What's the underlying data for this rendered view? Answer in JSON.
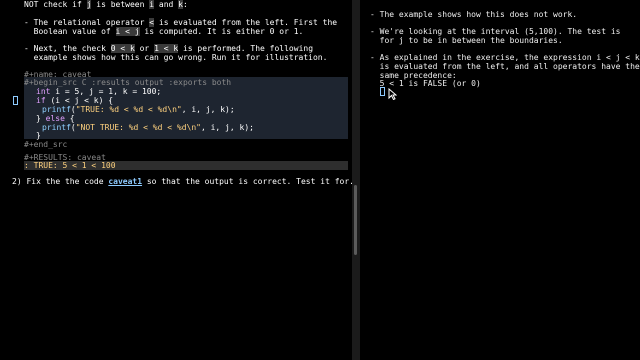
{
  "left": {
    "p0": {
      "a": "NOT check if ",
      "b": "j",
      "c": " is between ",
      "d": "i",
      "e": " and ",
      "f": "k",
      "g": ":"
    },
    "b1": {
      "a": "- The relational operator ",
      "b": "<",
      "c": " is evaluated from the left. First the",
      "d": "  Boolean value of ",
      "e": "i < j",
      "f": " is computed. It is either 0 or 1."
    },
    "b2": {
      "a": "- Next, the check ",
      "b": "0 < k",
      "c": " or ",
      "d": "1 < k",
      "e": " is performed. The following",
      "f": "  example shows how this can go wrong. Run it for illustration."
    },
    "src_name": "#+name: caveat",
    "src_begin": "#+begin_src C :results output :exports both",
    "code": {
      "l1_kw": "int",
      "l1_rest": " i = 5, j = 1, k = 100;",
      "l2_kw": "if",
      "l2_rest": " (i < j < k) {",
      "l3_fn": "printf",
      "l3_open": "(",
      "l3_str": "\"TRUE: %d < %d < %d\\n\"",
      "l3_rest": ", i, j, k);",
      "l4_a": "} ",
      "l4_kw": "else",
      "l4_b": " {",
      "l5_fn": "printf",
      "l5_open": "(",
      "l5_str": "\"NOT TRUE: %d < %d < %d\\n\"",
      "l5_rest": ", i, j, k);",
      "l6": "}"
    },
    "src_end": "#+end_src",
    "results_hdr": "#+RESULTS: caveat",
    "results_val": ": TRUE: 5 < 1 < 100",
    "task": {
      "a": "2) Fix the the code ",
      "link": "caveat1",
      "b": " so that the output is correct. Test it for..."
    }
  },
  "right": {
    "l1": "- The example shows how this does not work.",
    "l2": "- We're looking at the interval (5,100). The test is",
    "l3": "  for j to be in between the boundaries.",
    "l4": "- As explained in the exercise, the expression i < j < k",
    "l5": "  is evaluated from the left, and all operators have the",
    "l6": "  same precedence:",
    "l7": "  5 < 1 is FALSE (or 0)"
  }
}
